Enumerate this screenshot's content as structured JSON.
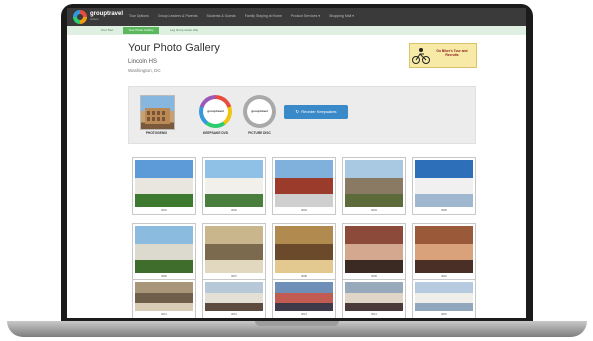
{
  "nav": {
    "brand": "grouptravel",
    "brand_sub": "videos",
    "items": [
      "Tour Options",
      "Group Leaders & Parents",
      "Students & Guests",
      "Family Staying at Home",
      "Product Services ▾",
      "Shopping Mall ▾"
    ]
  },
  "subnav": {
    "tabs": [
      "Your Tour",
      "Your Photo Gallery",
      "Log Out (Lincoln HS)"
    ],
    "active_index": 1
  },
  "page": {
    "title": "Your Photo Gallery",
    "school": "Lincoln HS",
    "location": "Washington, DC"
  },
  "sponsor": {
    "text": "Go Biker's Tour and Recruits"
  },
  "panel": {
    "photogenix_label": "PHOTOGENIX",
    "keepsake_label": "KEEPSAKE DVD",
    "keepsake_logo": "grouptravel",
    "picture_label": "PICTURE DISC",
    "picture_logo": "grouptravel",
    "reorder_button": "Reorder Keepsakes",
    "reorder_icon": "refresh-icon"
  },
  "gallery": {
    "photos": [
      {
        "caption": "0001",
        "subject": "capitol-building",
        "colors": [
          "#5d9bd8",
          "#e8e6df",
          "#3d7a2f"
        ]
      },
      {
        "caption": "0002",
        "subject": "jefferson-memorial",
        "colors": [
          "#8fc1e6",
          "#f2f0ea",
          "#4a7e3c"
        ]
      },
      {
        "caption": "0003",
        "subject": "red-brick-building",
        "colors": [
          "#7fb1dc",
          "#9a3b2c",
          "#cfcfcf"
        ]
      },
      {
        "caption": "0004",
        "subject": "cathedral",
        "colors": [
          "#a9c9e3",
          "#8b7a63",
          "#5d6b3a"
        ]
      },
      {
        "caption": "0005",
        "subject": "capitol-dome",
        "colors": [
          "#2d6fb8",
          "#f0f0f0",
          "#9fb8cf"
        ]
      },
      {
        "caption": "0006",
        "subject": "capitol-trees",
        "colors": [
          "#8bbce0",
          "#dcd9cf",
          "#3f6d2c"
        ]
      },
      {
        "caption": "0007",
        "subject": "rotunda-ceiling",
        "colors": [
          "#c9b68c",
          "#7b6a4e",
          "#e2d8c0"
        ]
      },
      {
        "caption": "0008",
        "subject": "painting-interior",
        "colors": [
          "#b08a4e",
          "#6a4a2a",
          "#e3c98f"
        ]
      },
      {
        "caption": "0009",
        "subject": "students-selfie",
        "colors": [
          "#8b4a3a",
          "#d4a88e",
          "#3b2a24"
        ]
      },
      {
        "caption": "0010",
        "subject": "students-group",
        "colors": [
          "#9a5a3a",
          "#d9a27a",
          "#4a2f26"
        ]
      },
      {
        "caption": "0011",
        "subject": "rotunda",
        "colors": [
          "#a9957a",
          "#6f5f4a",
          "#d8ccb6"
        ]
      },
      {
        "caption": "0012",
        "subject": "building-crowd",
        "colors": [
          "#b7c9d9",
          "#e5e0d6",
          "#5c4b3e"
        ]
      },
      {
        "caption": "0013",
        "subject": "crowd",
        "colors": [
          "#6d8fb8",
          "#c25b52",
          "#3e3a4a"
        ]
      },
      {
        "caption": "0014",
        "subject": "crowd-street",
        "colors": [
          "#97aabb",
          "#e0d6c8",
          "#4a3b3a"
        ]
      },
      {
        "caption": "0015",
        "subject": "capitol-dome-2",
        "colors": [
          "#b7cbe0",
          "#efeeea",
          "#90a7bd"
        ]
      }
    ]
  }
}
